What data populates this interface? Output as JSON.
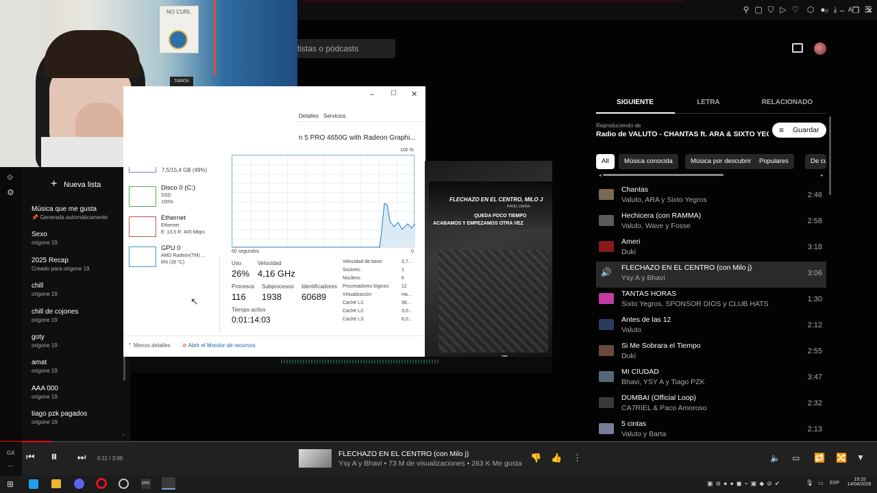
{
  "header": {
    "search_placeholder": "tistas o pódcasts"
  },
  "webcam": {
    "sign_text": "NO CURL",
    "sticker_text": "TAPATA"
  },
  "sidebar": {
    "new_list_label": "Nueva lista",
    "playlists": [
      {
        "title": "Música que me gusta",
        "sub": "Generada automáticamente"
      },
      {
        "title": "Sexo",
        "sub": "origone 19"
      },
      {
        "title": "2025 Recap",
        "sub": "Creado para origone 19"
      },
      {
        "title": "chill",
        "sub": "origone 19"
      },
      {
        "title": "chill de cojones",
        "sub": "origone 19"
      },
      {
        "title": "goty",
        "sub": "origone 19"
      },
      {
        "title": "amat",
        "sub": "origone 19"
      },
      {
        "title": "AAA 000",
        "sub": "origone 19"
      },
      {
        "title": "tiago pzk pagados",
        "sub": "origone 19"
      }
    ]
  },
  "taskmgr": {
    "tabs": [
      "Detalles",
      "Servicios"
    ],
    "cpu_name": "n 5 PRO 4650G with Radeon Graphi...",
    "percent_max": "100 %",
    "graph_time_label": "60 segundos",
    "graph_zero": "0",
    "memory_line": "7,5/15,4 GB (49%)",
    "devices": [
      {
        "name": "Disco 0 (C:)",
        "l1": "SSD",
        "l2": "100%",
        "color": "#4caf50"
      },
      {
        "name": "Ethernet",
        "l1": "Ethernet",
        "l2": "E: 13,5 R: 400 Mbps",
        "color": "#c0504d"
      },
      {
        "name": "GPU 0",
        "l1": "AMD Radeon(TM) ...",
        "l2": "8% (39 °C)",
        "color": "#3b9bc9"
      }
    ],
    "stats": {
      "uso_label": "Uso",
      "uso": "26%",
      "velocidad_label": "Velocidad",
      "velocidad": "4,16 GHz",
      "procesos_label": "Procesos",
      "procesos": "116",
      "subprocesos_label": "Subprocesos",
      "subprocesos": "1938",
      "ident_label": "Identificadores",
      "ident": "60689",
      "tiempo_label": "Tiempo activo",
      "tiempo": "0:01:14:03"
    },
    "specs": [
      {
        "k": "Velocidad de base:",
        "v": "3,7..."
      },
      {
        "k": "Sockets:",
        "v": "1"
      },
      {
        "k": "Núcleos:",
        "v": "6"
      },
      {
        "k": "Procesadores lógicos:",
        "v": "12"
      },
      {
        "k": "Virtualización:",
        "v": "Ha..."
      },
      {
        "k": "Caché L1:",
        "v": "38..."
      },
      {
        "k": "Caché L2:",
        "v": "3,0..."
      },
      {
        "k": "Caché L3:",
        "v": "8,0..."
      }
    ],
    "less_details": "Menos detalles",
    "open_monitor": "Abrir el Monitor de recursos"
  },
  "video": {
    "title_line": "FLECHAZO EN EL CENTRO, MILO J",
    "prod": "PROD. DWIRA",
    "lyric1": "QUEDA POCO TIEMPO",
    "lyric2": "ACABAMOS Y EMPEZAMOS OTRA VEZ"
  },
  "right_panel": {
    "tabs": [
      "SIGUIENTE",
      "LETRA",
      "RELACIONADO"
    ],
    "playing_from_label": "Reproduciendo de",
    "playing_from": "Radio de VALUTO - CHANTAS ft. ARA & SIXTO YEG...",
    "save_label": "Guardar",
    "chips": [
      "All",
      "Música conocida",
      "Música por descubrir",
      "Populares",
      "De cu"
    ],
    "queue": [
      {
        "title": "Chantas",
        "artist": "Valuto, ARA y Sixto Yegros",
        "duration": "2:46",
        "color": "#7a6a55"
      },
      {
        "title": "Hechicera (con RAMMA)",
        "artist": "Valuto, Wave y Fosse",
        "duration": "2:58",
        "color": "#5b5b5b"
      },
      {
        "title": "Ameri",
        "artist": "Duki",
        "duration": "3:18",
        "color": "#8a1a1a"
      },
      {
        "title": "FLECHAZO EN EL CENTRO (con Milo j)",
        "artist": "Ysy A y Bhavi",
        "duration": "3:06",
        "color": "#444"
      },
      {
        "title": "TANTAS HORAS",
        "artist": "Sixto Yegros, SPONSOR DIOS y CLUB HATS",
        "duration": "1:30",
        "color": "#c23ba4"
      },
      {
        "title": "Antes de las 12",
        "artist": "Valuto",
        "duration": "2:12",
        "color": "#2c3b5c"
      },
      {
        "title": "Si Me Sobrara el Tiempo",
        "artist": "Duki",
        "duration": "2:55",
        "color": "#6a4a3a"
      },
      {
        "title": "MI CIUDAD",
        "artist": "Bhavi, YSY A y Tiago PZK",
        "duration": "3:47",
        "color": "#55677a"
      },
      {
        "title": "DUMBAI (Official Loop)",
        "artist": "CA7RIEL & Paco Amoroso",
        "duration": "2:32",
        "color": "#3a3a3a"
      },
      {
        "title": "5 cintas",
        "artist": "Valuto y Barta",
        "duration": "2:13",
        "color": "#7a7a9a"
      }
    ]
  },
  "player": {
    "time": "0:11 / 3:06",
    "title": "FLECHAZO EN EL CENTRO (con Milo j)",
    "subtitle": "Ysy A y Bhavi • 73 M de visualizaciones • 263 K Me gusta",
    "progress_fraction": 0.059,
    "gx_label": "GX"
  },
  "taskbar": {
    "lang": "ESP",
    "time": "19:15",
    "date": "14/04/2026"
  }
}
